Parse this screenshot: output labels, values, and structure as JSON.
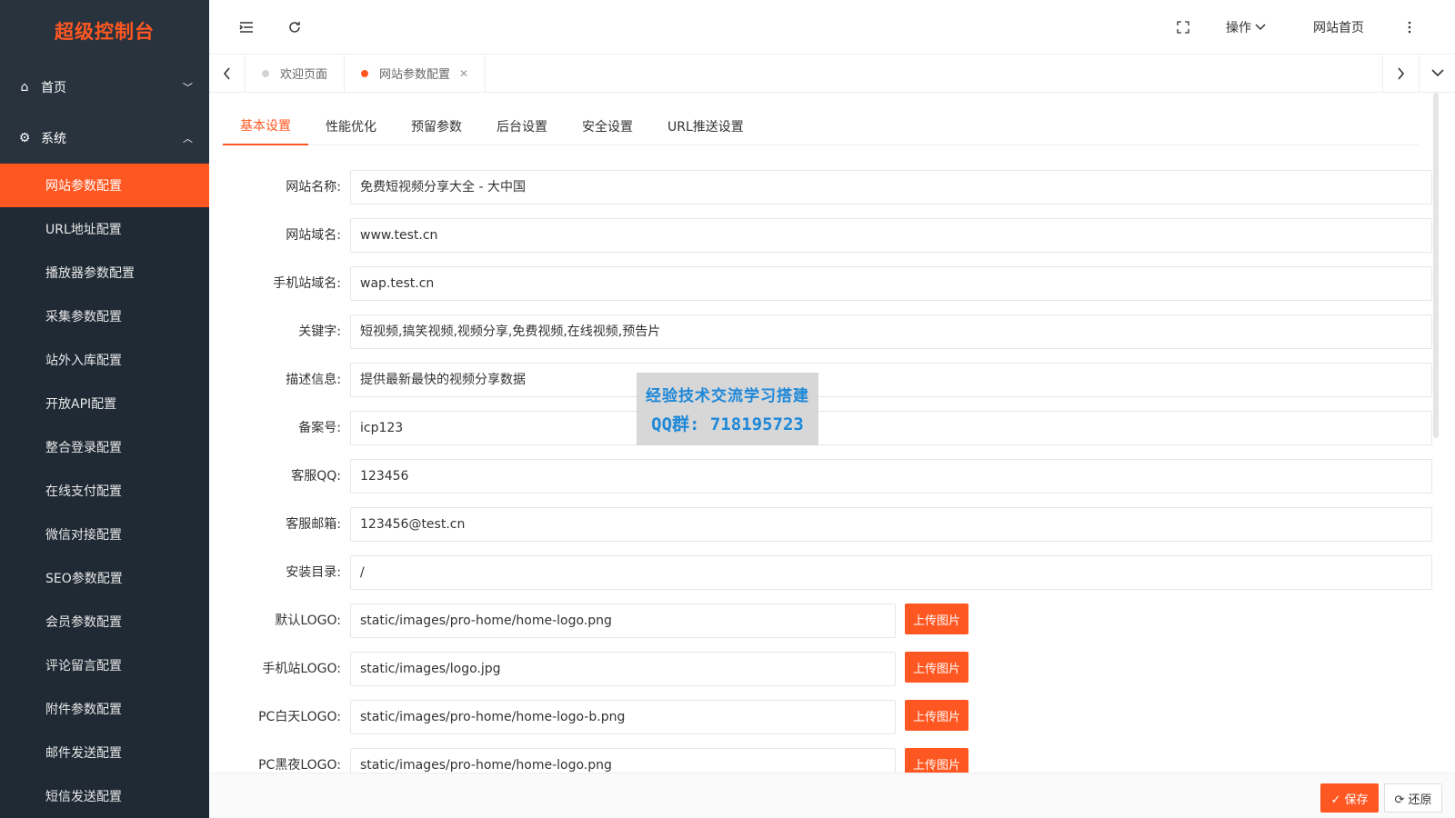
{
  "sidebar": {
    "brand": "超级控制台",
    "groups": [
      {
        "icon": "home-icon",
        "label": "首页"
      },
      {
        "icon": "system-icon",
        "label": "系统"
      }
    ],
    "items": [
      {
        "label": "网站参数配置",
        "active": true
      },
      {
        "label": "URL地址配置"
      },
      {
        "label": "播放器参数配置"
      },
      {
        "label": "采集参数配置"
      },
      {
        "label": "站外入库配置"
      },
      {
        "label": "开放API配置"
      },
      {
        "label": "整合登录配置"
      },
      {
        "label": "在线支付配置"
      },
      {
        "label": "微信对接配置"
      },
      {
        "label": "SEO参数配置"
      },
      {
        "label": "会员参数配置"
      },
      {
        "label": "评论留言配置"
      },
      {
        "label": "附件参数配置"
      },
      {
        "label": "邮件发送配置"
      },
      {
        "label": "短信发送配置"
      }
    ]
  },
  "header": {
    "menu_icon": "menu-fold-icon",
    "refresh_icon": "refresh-icon",
    "fullscreen_icon": "fullscreen-icon",
    "ops_label": "操作",
    "home_label": "网站首页",
    "more_icon": "more-vertical-icon"
  },
  "page_tabs": [
    {
      "label": "欢迎页面"
    },
    {
      "label": "网站参数配置",
      "active": true
    }
  ],
  "config_tabs": [
    "基本设置",
    "性能优化",
    "预留参数",
    "后台设置",
    "安全设置",
    "URL推送设置"
  ],
  "form": {
    "rows": [
      {
        "label": "网站名称:",
        "value": "免费短视频分享大全 - 大中国"
      },
      {
        "label": "网站域名:",
        "value": "www.test.cn"
      },
      {
        "label": "手机站域名:",
        "value": "wap.test.cn"
      },
      {
        "label": "关键字:",
        "value": "短视频,搞笑视频,视频分享,免费视频,在线视频,预告片"
      },
      {
        "label": "描述信息:",
        "value": "提供最新最快的视频分享数据"
      },
      {
        "label": "备案号:",
        "value": "icp123"
      },
      {
        "label": "客服QQ:",
        "value": "123456"
      },
      {
        "label": "客服邮箱:",
        "value": "123456@test.cn"
      },
      {
        "label": "安装目录:",
        "value": "/"
      },
      {
        "label": "默认LOGO:",
        "value": "static/images/pro-home/home-logo.png",
        "upload": "上传图片"
      },
      {
        "label": "手机站LOGO:",
        "value": "static/images/logo.jpg",
        "upload": "上传图片"
      },
      {
        "label": "PC白天LOGO:",
        "value": "static/images/pro-home/home-logo-b.png",
        "upload": "上传图片"
      },
      {
        "label": "PC黑夜LOGO:",
        "value": "static/images/pro-home/home-logo.png",
        "upload": "上传图片"
      }
    ]
  },
  "footer": {
    "save_label": "✓ 保存",
    "reset_label": "⟳ 还原"
  },
  "watermark": {
    "line1": "经验技术交流学习搭建",
    "line2": "QQ群: 718195723"
  },
  "colors": {
    "accent": "#ff5722",
    "sidebar_bg": "#28333e",
    "sidebar_sub_bg": "#1f2a35"
  }
}
